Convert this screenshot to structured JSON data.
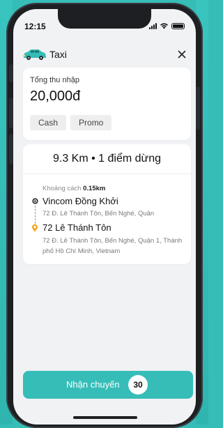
{
  "status_bar": {
    "time": "12:15"
  },
  "header": {
    "title": "Taxi",
    "icon": "taxi-car-icon",
    "close_icon": "close-icon"
  },
  "earnings": {
    "label": "Tổng thu nhập",
    "amount": "20,000đ",
    "chips": [
      "Cash",
      "Promo"
    ]
  },
  "route": {
    "summary": "9.3 Km • 1 điểm dừng",
    "distance_label": "Khoảng cách",
    "distance_value": "0.15km",
    "stops": [
      {
        "name": "Vincom Đồng Khởi",
        "address": "72 Đ. Lê Thánh Tôn, Bến Nghé, Quận"
      },
      {
        "name": "72 Lê Thánh Tôn",
        "address": "72 Đ. Lê Thánh Tôn, Bến Nghé, Quận 1, Thành phố Hồ Chí Minh, Vietnam"
      }
    ]
  },
  "action": {
    "accept_label": "Nhận chuyến",
    "countdown": "30"
  },
  "colors": {
    "accent": "#36bdb8",
    "pin_orange": "#f5a623"
  }
}
